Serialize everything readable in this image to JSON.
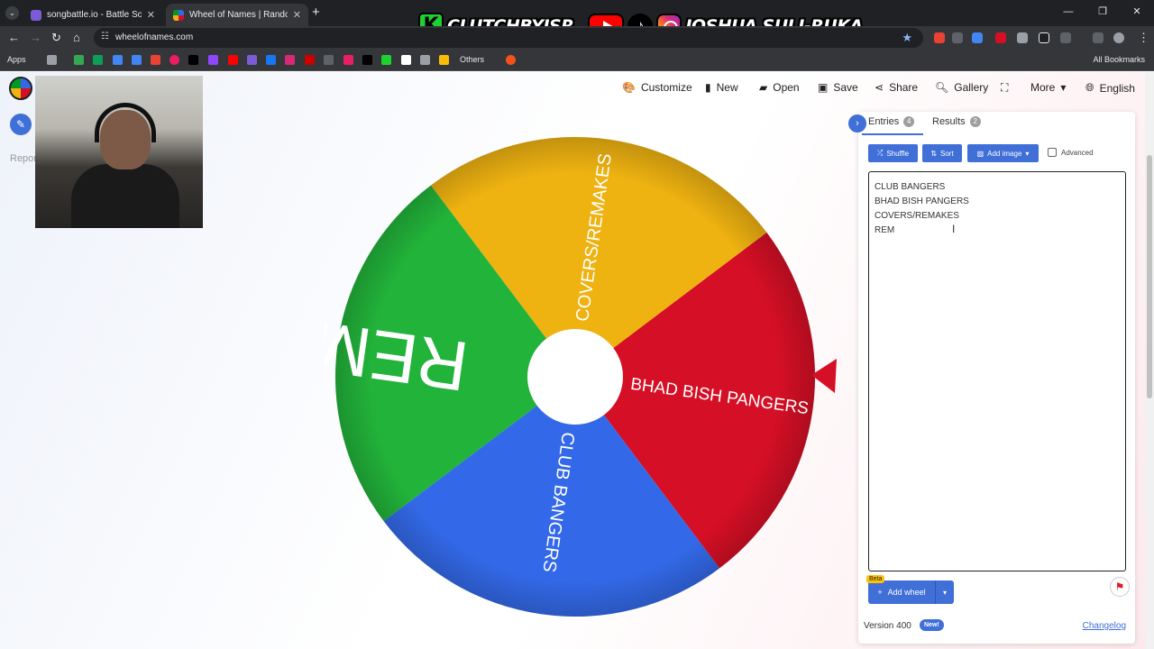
{
  "browser": {
    "tabs": [
      {
        "title": "songbattle.io - Battle Songs ag",
        "favicon_color": "#7b5cd6"
      },
      {
        "title": "Wheel of Names | Random nam",
        "favicon_color": "#eeb211"
      }
    ],
    "url": "wheelofnames.com",
    "bookmarks": {
      "apps_label": "Apps",
      "others_label": "Others",
      "all_label": "All Bookmarks"
    }
  },
  "overlay": {
    "brand": "CLUTCHBYJSR",
    "k_letter": "K",
    "name": "JOSHUA SULI-RUKA"
  },
  "header": {
    "customize": "Customize",
    "new": "New",
    "open": "Open",
    "save": "Save",
    "share": "Share",
    "gallery": "Gallery",
    "more": "More",
    "language": "English"
  },
  "left": {
    "report_label": "Report"
  },
  "wheel": {
    "segments": [
      {
        "label": "BHAD BISH PANGERS",
        "color": "#d50f25"
      },
      {
        "label": "CLUB BANGERS",
        "color": "#3369e8"
      },
      {
        "label": "REM",
        "color": "#22b33a"
      },
      {
        "label": "COVERS/REMAKES",
        "color": "#eeb211"
      }
    ],
    "pointer_color": "#d50f25"
  },
  "panel": {
    "entries_tab": "Entries",
    "entries_count": "4",
    "results_tab": "Results",
    "results_count": "2",
    "shuffle": "Shuffle",
    "sort": "Sort",
    "add_image": "Add image",
    "advanced": "Advanced",
    "entries": [
      "CLUB BANGERS",
      "BHAD BISH PANGERS",
      "COVERS/REMAKES",
      "REM"
    ],
    "beta": "Beta",
    "add_wheel": "Add wheel",
    "version": "Version 400",
    "new_badge": "New!",
    "changelog": "Changelog"
  }
}
